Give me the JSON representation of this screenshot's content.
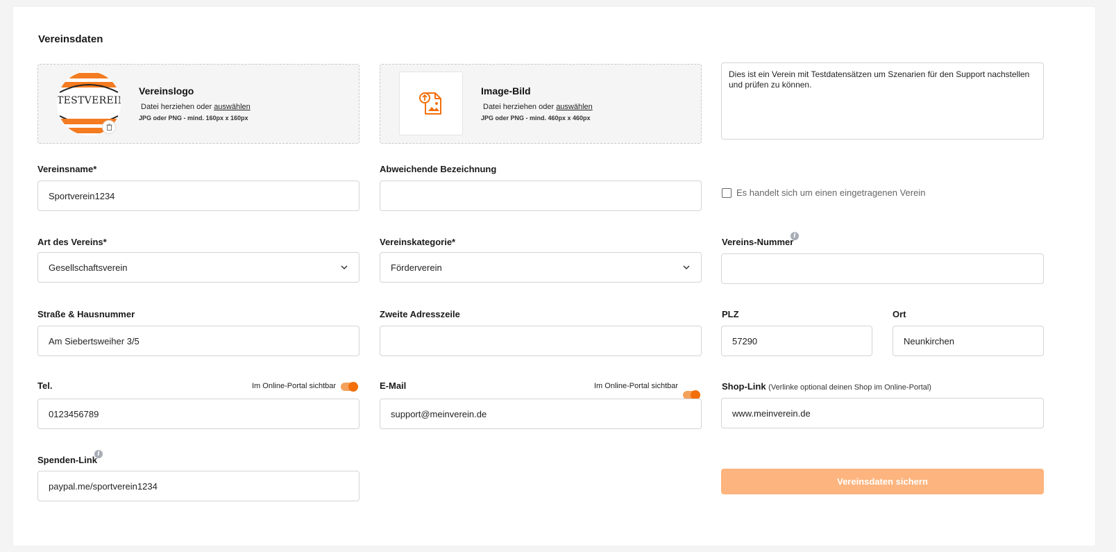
{
  "section": {
    "title": "Vereinsdaten"
  },
  "logo_upload": {
    "title": "Vereinslogo",
    "hint_prefix": "Datei herziehen oder",
    "hint_link": "auswählen",
    "requirements": "JPG oder PNG - mind. 160px x 160px",
    "logo_text": "TESTVEREIN",
    "delete_icon": "trash-icon"
  },
  "image_upload": {
    "title": "Image-Bild",
    "hint_prefix": "Datei herziehen oder",
    "hint_link": "auswählen",
    "requirements": "JPG oder PNG - mind. 460px x 460px",
    "icon": "image-upload-icon"
  },
  "description": {
    "value": "Dies ist ein Verein mit Testdatensätzen um Szenarien für den Support nachstellen und prüfen zu können."
  },
  "fields": {
    "vereinsname": {
      "label": "Vereinsname*",
      "value": "Sportverein1234"
    },
    "abweichende_bezeichnung": {
      "label": "Abweichende Bezeichnung",
      "value": ""
    },
    "eingetragen": {
      "label": "Es handelt sich um einen eingetragenen Verein",
      "checked": false
    },
    "art": {
      "label": "Art des Vereins*",
      "value": "Gesellschaftsverein"
    },
    "kategorie": {
      "label": "Vereinskategorie*",
      "value": "Förderverein"
    },
    "nummer": {
      "label": "Vereins-Nummer",
      "value": "",
      "icon": "info-icon"
    },
    "strasse": {
      "label": "Straße & Hausnummer",
      "value": "Am Siebertsweiher 3/5"
    },
    "adresszeile2": {
      "label": "Zweite Adresszeile",
      "value": ""
    },
    "plz": {
      "label": "PLZ",
      "value": "57290"
    },
    "ort": {
      "label": "Ort",
      "value": "Neunkirchen"
    },
    "tel": {
      "label": "Tel.",
      "value": "0123456789",
      "visibility_label": "Im Online-Portal sichtbar",
      "visible": true
    },
    "email": {
      "label": "E-Mail",
      "value": "support@meinverein.de",
      "visibility_label": "Im Online-Portal sichtbar",
      "visible": true
    },
    "shop": {
      "label": "Shop-Link",
      "note": "(Verlinke optional deinen Shop im Online-Portal)",
      "value": "www.meinverein.de"
    },
    "spenden": {
      "label": "Spenden-Link",
      "value": "paypal.me/sportverein1234",
      "icon": "info-icon"
    }
  },
  "actions": {
    "save_label": "Vereinsdaten sichern"
  },
  "colors": {
    "accent": "#f36f0a",
    "toggle_track": "#f4a15c",
    "save_button": "#fdb47e"
  }
}
